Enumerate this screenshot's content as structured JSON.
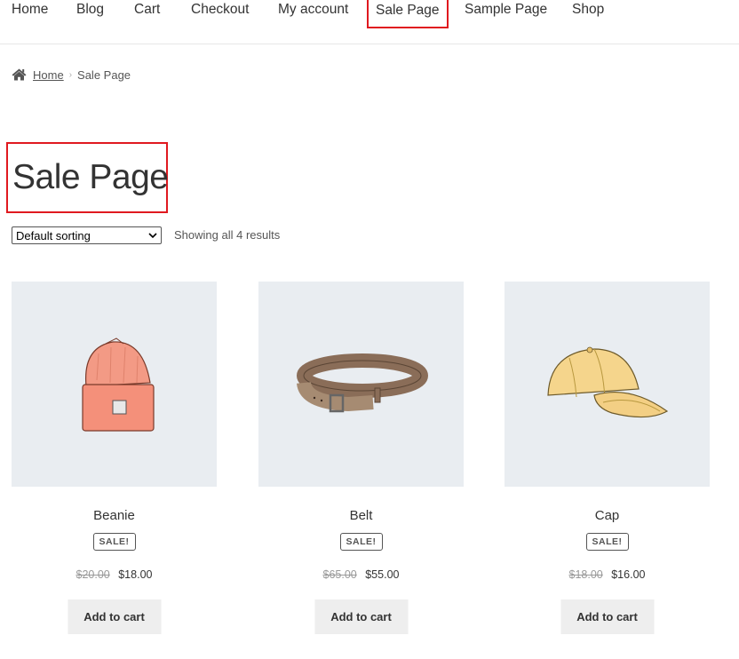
{
  "nav": {
    "items": [
      {
        "label": "Home"
      },
      {
        "label": "Blog"
      },
      {
        "label": "Cart"
      },
      {
        "label": "Checkout"
      },
      {
        "label": "My account"
      },
      {
        "label": "Sale Page"
      },
      {
        "label": "Sample Page"
      },
      {
        "label": "Shop"
      }
    ]
  },
  "breadcrumb": {
    "home_icon": "home-icon",
    "home": "Home",
    "current": "Sale Page"
  },
  "page": {
    "title": "Sale Page"
  },
  "sorting": {
    "selected": "Default sorting",
    "result_count": "Showing all 4 results"
  },
  "products": [
    {
      "name": "Beanie",
      "badge": "SALE!",
      "old_price": "$20.00",
      "new_price": "$18.00",
      "button": "Add to cart",
      "image": "beanie"
    },
    {
      "name": "Belt",
      "badge": "SALE!",
      "old_price": "$65.00",
      "new_price": "$55.00",
      "button": "Add to cart",
      "image": "belt"
    },
    {
      "name": "Cap",
      "badge": "SALE!",
      "old_price": "$18.00",
      "new_price": "$16.00",
      "button": "Add to cart",
      "image": "cap"
    }
  ],
  "colors": {
    "highlight": "#e0191f",
    "image_bg": "#e9edf1",
    "button_bg": "#eeeeee"
  }
}
